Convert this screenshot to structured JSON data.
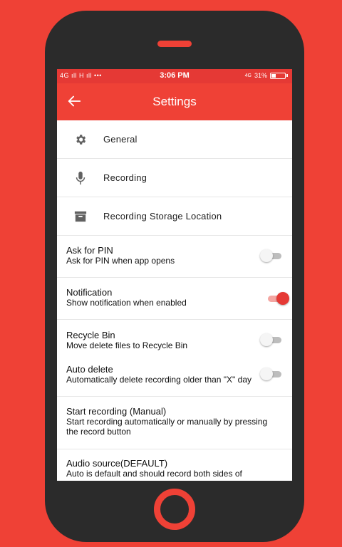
{
  "statusbar": {
    "left": "4G ıll  H ıll   •••",
    "time": "3:06 PM",
    "right_net": "4G",
    "battery": "31%"
  },
  "appbar": {
    "title": "Settings"
  },
  "menu": [
    {
      "label": "General",
      "icon": "gear-icon"
    },
    {
      "label": "Recording",
      "icon": "microphone-icon"
    },
    {
      "label": "Recording Storage Location",
      "icon": "archive-box-icon"
    }
  ],
  "settings": {
    "ask_pin": {
      "title": "Ask for PIN",
      "sub": "Ask for PIN when app opens",
      "enabled": false
    },
    "notification": {
      "title": "Notification",
      "sub": "Show notification when enabled",
      "enabled": true
    },
    "recycle_bin": {
      "title": "Recycle Bin",
      "sub": "Move delete files to Recycle Bin",
      "enabled": false
    },
    "auto_delete": {
      "title": "Auto delete",
      "sub": "Automatically delete recording older than \"X\" day",
      "enabled": false
    },
    "start_recording": {
      "title": "Start recording (Manual)",
      "sub": "Start recording automatically or manually by pressing the record button"
    },
    "audio_source": {
      "title": "Audio source(DEFAULT)",
      "sub": "Auto is default and should record both sides of"
    }
  },
  "colors": {
    "accent": "#ef4136",
    "statusbar": "#e53935",
    "frame": "#2b2b2b"
  }
}
